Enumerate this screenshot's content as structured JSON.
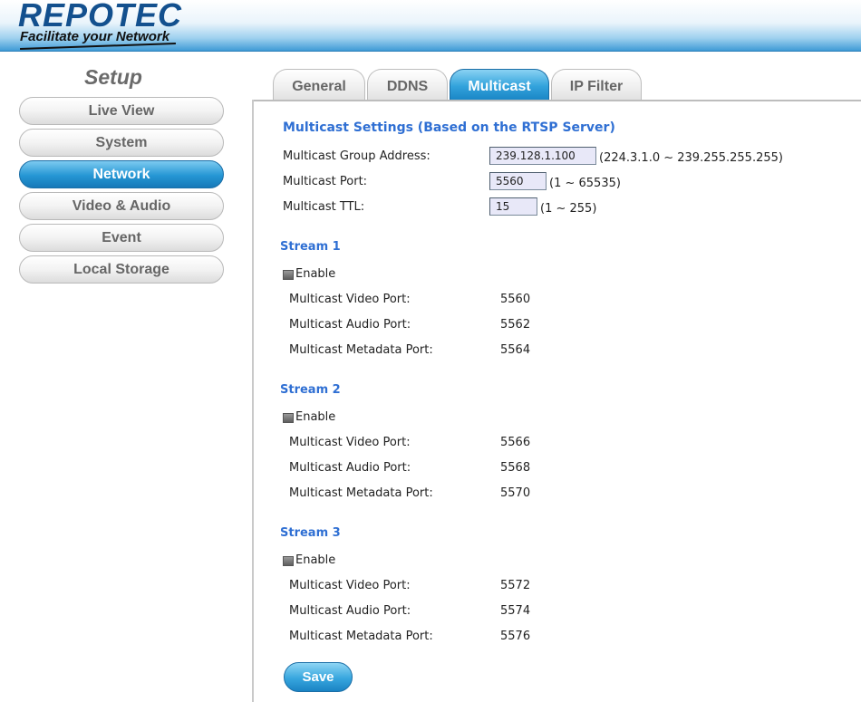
{
  "header": {
    "logo_text": "REPOTEC",
    "tagline": "Facilitate your Network"
  },
  "sidebar": {
    "title": "Setup",
    "items": [
      {
        "label": "Live View",
        "active": false
      },
      {
        "label": "System",
        "active": false
      },
      {
        "label": "Network",
        "active": true
      },
      {
        "label": "Video & Audio",
        "active": false
      },
      {
        "label": "Event",
        "active": false
      },
      {
        "label": "Local Storage",
        "active": false
      }
    ]
  },
  "tabs": [
    {
      "label": "General",
      "active": false
    },
    {
      "label": "DDNS",
      "active": false
    },
    {
      "label": "Multicast",
      "active": true
    },
    {
      "label": "IP Filter",
      "active": false
    }
  ],
  "multicast": {
    "title": "Multicast Settings (Based on the RTSP Server)",
    "group_address": {
      "label": "Multicast Group Address:",
      "value": "239.128.1.100",
      "range": "(224.3.1.0 ~ 239.255.255.255)"
    },
    "port": {
      "label": "Multicast Port:",
      "value": "5560",
      "range": "(1 ~ 65535)"
    },
    "ttl": {
      "label": "Multicast TTL:",
      "value": "15",
      "range": "(1 ~ 255)"
    }
  },
  "streams": [
    {
      "title": "Stream 1",
      "enable_label": "Enable",
      "enabled": false,
      "video_label": "Multicast Video Port:",
      "video_port": "5560",
      "audio_label": "Multicast Audio Port:",
      "audio_port": "5562",
      "metadata_label": "Multicast Metadata Port:",
      "metadata_port": "5564"
    },
    {
      "title": "Stream 2",
      "enable_label": "Enable",
      "enabled": false,
      "video_label": "Multicast Video Port:",
      "video_port": "5566",
      "audio_label": "Multicast Audio Port:",
      "audio_port": "5568",
      "metadata_label": "Multicast Metadata Port:",
      "metadata_port": "5570"
    },
    {
      "title": "Stream 3",
      "enable_label": "Enable",
      "enabled": false,
      "video_label": "Multicast Video Port:",
      "video_port": "5572",
      "audio_label": "Multicast Audio Port:",
      "audio_port": "5574",
      "metadata_label": "Multicast Metadata Port:",
      "metadata_port": "5576"
    }
  ],
  "save_label": "Save",
  "colors": {
    "accent": "#2596d4",
    "section_title": "#2f6fd3",
    "input_bg": "#e8e8f8"
  }
}
